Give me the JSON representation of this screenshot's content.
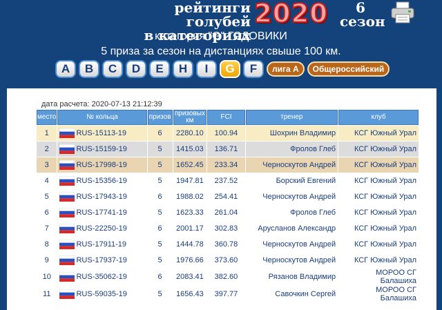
{
  "header": {
    "title_line1": "рейтинги голубей",
    "title_line2": "в категориях",
    "year": "2020",
    "season_num": "6",
    "season_label": "сезон",
    "printer_icon": "printer-icon"
  },
  "subtitle": {
    "line1": "категория \"G\" ГОДОВИКИ",
    "line2": "5 приза за сезон на дистанциях свыше 100 км."
  },
  "categories": [
    "A",
    "B",
    "C",
    "D",
    "E",
    "H",
    "I",
    "G",
    "F"
  ],
  "active_category": "G",
  "pills": {
    "league": "лига А",
    "national": "Общероссийский"
  },
  "calc_date": "дата расчета: 2020-07-13 21:12:39",
  "table": {
    "headers": {
      "rank": "место",
      "ring": "№ кольца",
      "prizes": "призов",
      "distance": "призовых км",
      "fci": "FCI",
      "trainer": "тренер",
      "club": "клуб"
    },
    "rows": [
      {
        "rank": "1",
        "ring": "RUS-15113-19",
        "prizes": "6",
        "distance": "2280.10",
        "fci": "100.94",
        "trainer": "Шохрин Владимир",
        "club": "КСГ Южный Урал"
      },
      {
        "rank": "2",
        "ring": "RUS-15159-19",
        "prizes": "5",
        "distance": "1415.03",
        "fci": "136.71",
        "trainer": "Фролов Глеб",
        "club": "КСГ Южный Урал"
      },
      {
        "rank": "3",
        "ring": "RUS-17998-19",
        "prizes": "5",
        "distance": "1652.45",
        "fci": "233.34",
        "trainer": "Черноскутов Андрей",
        "club": "КСГ Южный Урал"
      },
      {
        "rank": "4",
        "ring": "RUS-15356-19",
        "prizes": "5",
        "distance": "1947.81",
        "fci": "237.52",
        "trainer": "Борский Евгений",
        "club": "КСГ Южный Урал"
      },
      {
        "rank": "5",
        "ring": "RUS-17943-19",
        "prizes": "6",
        "distance": "1988.02",
        "fci": "254.41",
        "trainer": "Черноскутов Андрей",
        "club": "КСГ Южный Урал"
      },
      {
        "rank": "6",
        "ring": "RUS-17741-19",
        "prizes": "5",
        "distance": "1623.33",
        "fci": "261.04",
        "trainer": "Фролов Глеб",
        "club": "КСГ Южный Урал"
      },
      {
        "rank": "7",
        "ring": "RUS-22250-19",
        "prizes": "6",
        "distance": "2001.17",
        "fci": "302.83",
        "trainer": "Арусланов Александр",
        "club": "КСГ Южный Урал"
      },
      {
        "rank": "8",
        "ring": "RUS-17911-19",
        "prizes": "5",
        "distance": "1444.78",
        "fci": "360.78",
        "trainer": "Черноскутов Андрей",
        "club": "КСГ Южный Урал"
      },
      {
        "rank": "9",
        "ring": "RUS-17937-19",
        "prizes": "5",
        "distance": "1976.66",
        "fci": "373.60",
        "trainer": "Черноскутов Андрей",
        "club": "КСГ Южный Урал"
      },
      {
        "rank": "10",
        "ring": "RUS-35062-19",
        "prizes": "6",
        "distance": "2083.41",
        "fci": "382.60",
        "trainer": "Рязанов Владимир",
        "club": "МОРОО СГ Балашиха"
      },
      {
        "rank": "11",
        "ring": "RUS-59035-19",
        "prizes": "5",
        "distance": "1656.43",
        "fci": "397.77",
        "trainer": "Савочкин Сергей",
        "club": "МОРОО СГ Балашиха"
      }
    ]
  },
  "colors": {
    "background": "#14427a",
    "header_cell": "#5a9ad8",
    "row_highlight_1": "#f8ecc4",
    "row_highlight_2": "#dcdcdc",
    "row_highlight_3": "#ead5b2",
    "active_tab": "#f0a500",
    "pill": "#b9651a"
  },
  "flag_icon": "russia-flag-icon"
}
